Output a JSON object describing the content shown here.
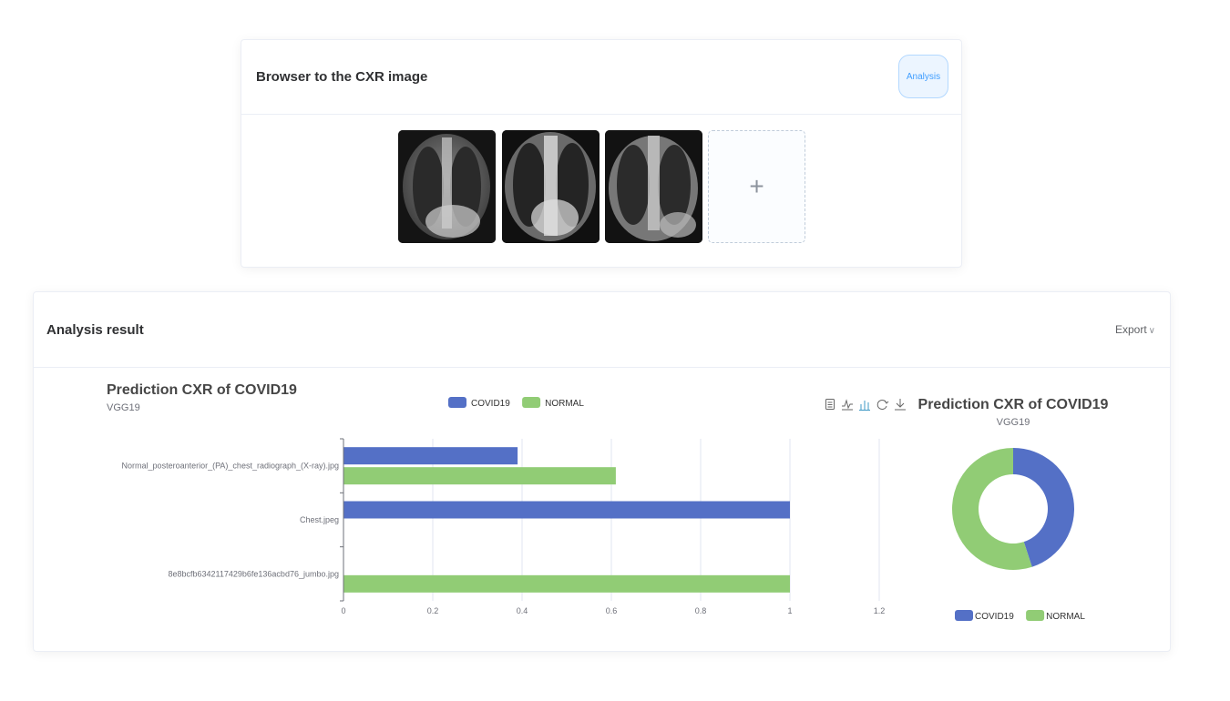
{
  "upload": {
    "title": "Browser to the CXR image",
    "analysis_label": "Analysis",
    "add_label": "+"
  },
  "result": {
    "title": "Analysis result",
    "export_label": "Export",
    "export_chevron": "∨"
  },
  "toolbox": [
    "data-view-icon",
    "line-chart-icon",
    "bar-chart-icon",
    "refresh-icon",
    "download-icon"
  ],
  "colors": {
    "covid": "#5470c6",
    "normal": "#91cc75",
    "accent": "#409eff"
  },
  "chart_data": [
    {
      "type": "bar",
      "orientation": "horizontal",
      "title": "Prediction CXR of COVID19",
      "subtitle": "VGG19",
      "categories": [
        "Normal_posteroanterior_(PA)_chest_radiograph_(X-ray).jpg",
        "Chest.jpeg",
        "8e8bcfb6342117429b6fe136acbd76_jumbo.jpg"
      ],
      "series": [
        {
          "name": "COVID19",
          "values": [
            0.39,
            1,
            0
          ]
        },
        {
          "name": "NORMAL",
          "values": [
            0.61,
            0,
            1
          ]
        }
      ],
      "xlim": [
        0,
        1.2
      ],
      "xticks": [
        "0",
        "0.2",
        "0.4",
        "0.6",
        "0.8",
        "1",
        "1.2"
      ],
      "grid": true,
      "legend": "top-center"
    },
    {
      "type": "pie",
      "title": "Prediction CXR of COVID19",
      "subtitle": "VGG19",
      "categories": [
        "COVID19",
        "NORMAL"
      ],
      "values": [
        0.45,
        0.55
      ],
      "legend": "bottom"
    }
  ]
}
